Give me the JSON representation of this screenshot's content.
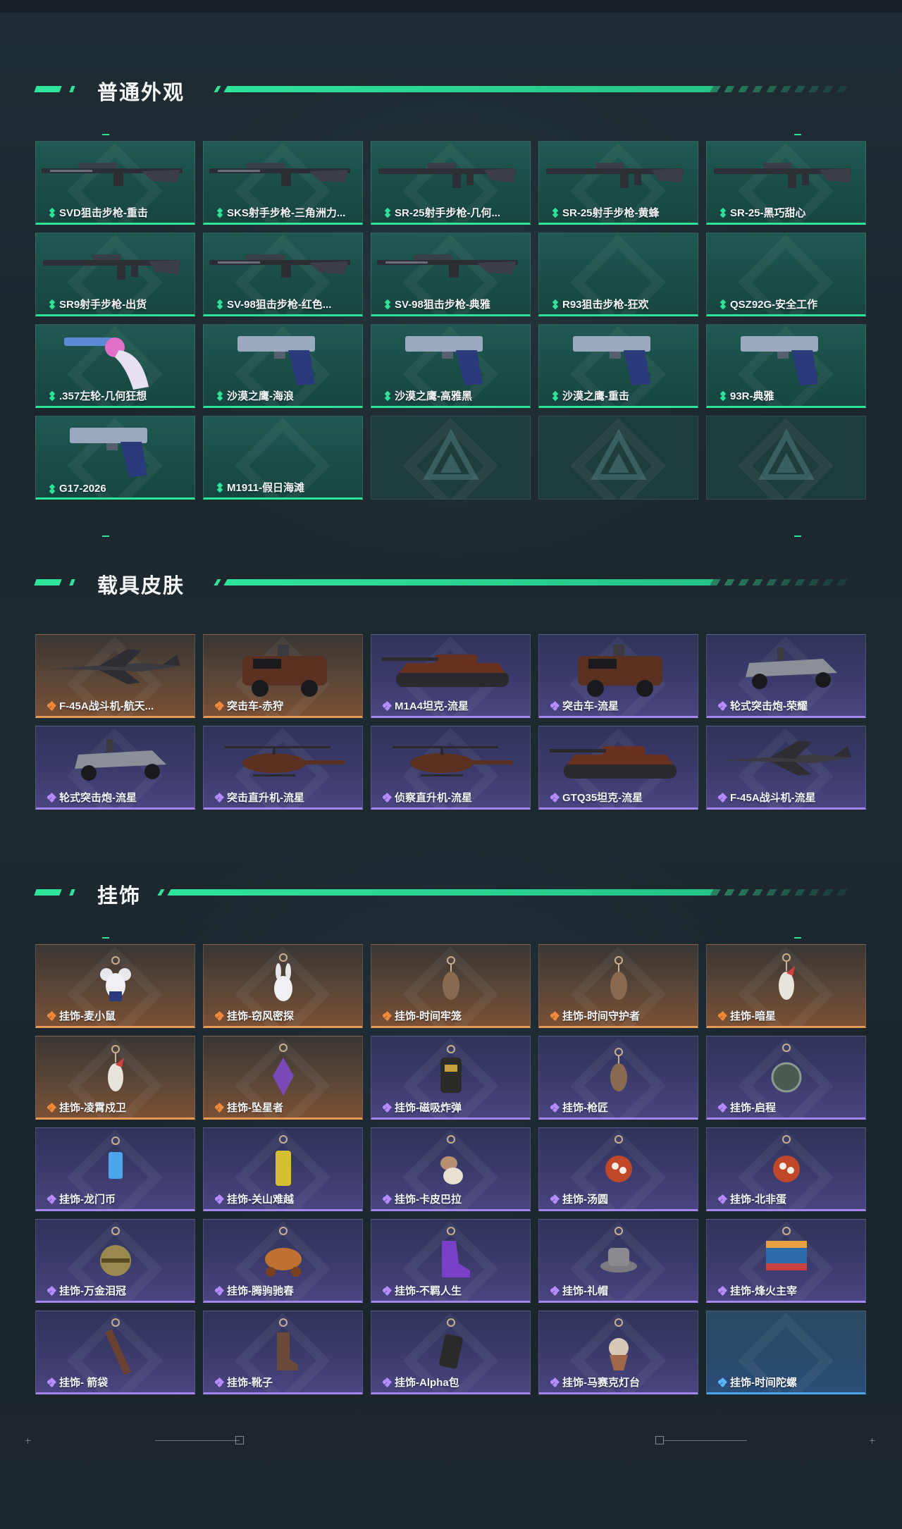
{
  "sections": [
    {
      "title": "普通外观",
      "items": [
        {
          "label": "SVD狙击步枪-重击",
          "rarity": "green",
          "icon": "sniper-rifle"
        },
        {
          "label": "SKS射手步枪-三角洲力...",
          "rarity": "green",
          "icon": "sniper-rifle"
        },
        {
          "label": "SR-25射手步枪-几何...",
          "rarity": "green",
          "icon": "rifle"
        },
        {
          "label": "SR-25射手步枪-黄蜂",
          "rarity": "green",
          "icon": "rifle"
        },
        {
          "label": "SR-25-黑巧甜心",
          "rarity": "green",
          "icon": "rifle"
        },
        {
          "label": "SR9射手步枪-出货",
          "rarity": "green",
          "icon": "rifle"
        },
        {
          "label": "SV-98狙击步枪-红色...",
          "rarity": "green",
          "icon": "sniper-rifle"
        },
        {
          "label": "SV-98狙击步枪-典雅",
          "rarity": "green",
          "icon": "sniper-rifle"
        },
        {
          "label": "R93狙击步枪-狂欢",
          "rarity": "green",
          "icon": ""
        },
        {
          "label": "QSZ92G-安全工作",
          "rarity": "green",
          "icon": ""
        },
        {
          "label": ".357左轮-几何狂想",
          "rarity": "green",
          "icon": "revolver"
        },
        {
          "label": "沙漠之鹰-海浪",
          "rarity": "green",
          "icon": "pistol"
        },
        {
          "label": "沙漠之鹰-高雅黑",
          "rarity": "green",
          "icon": "pistol"
        },
        {
          "label": "沙漠之鹰-重击",
          "rarity": "green",
          "icon": "pistol"
        },
        {
          "label": "93R-典雅",
          "rarity": "green",
          "icon": "pistol"
        },
        {
          "label": "G17-2026",
          "rarity": "green",
          "icon": "pistol"
        },
        {
          "label": "M1911-假日海滩",
          "rarity": "green",
          "icon": ""
        },
        {
          "label": "",
          "rarity": "empty",
          "icon": "delta-emblem"
        },
        {
          "label": "",
          "rarity": "empty",
          "icon": "delta-emblem"
        },
        {
          "label": "",
          "rarity": "empty",
          "icon": "delta-emblem"
        }
      ]
    },
    {
      "title": "载具皮肤",
      "items": [
        {
          "label": "F-45A战斗机-航天...",
          "rarity": "orange",
          "icon": "fighter-jet"
        },
        {
          "label": "突击车-赤狩",
          "rarity": "orange",
          "icon": "assault-vehicle"
        },
        {
          "label": "M1A4坦克-流星",
          "rarity": "purple",
          "icon": "tank"
        },
        {
          "label": "突击车-流星",
          "rarity": "purple",
          "icon": "assault-vehicle"
        },
        {
          "label": "轮式突击炮-荣耀",
          "rarity": "purple",
          "icon": "wheeled-vehicle"
        },
        {
          "label": "轮式突击炮-流星",
          "rarity": "purple",
          "icon": "wheeled-vehicle"
        },
        {
          "label": "突击直升机-流星",
          "rarity": "purple",
          "icon": "helicopter"
        },
        {
          "label": "侦察直升机-流星",
          "rarity": "purple",
          "icon": "helicopter"
        },
        {
          "label": "GTQ35坦克-流星",
          "rarity": "purple",
          "icon": "tank"
        },
        {
          "label": "F-45A战斗机-流星",
          "rarity": "purple",
          "icon": "fighter-jet"
        }
      ]
    },
    {
      "title": "挂饰",
      "items": [
        {
          "label": "挂饰-麦小鼠",
          "rarity": "orange",
          "icon": "mouse-charm"
        },
        {
          "label": "挂饰-窃风密探",
          "rarity": "orange",
          "icon": "rabbit-charm"
        },
        {
          "label": "挂饰-时间牢笼",
          "rarity": "orange",
          "icon": "charm"
        },
        {
          "label": "挂饰-时间守护者",
          "rarity": "orange",
          "icon": "charm"
        },
        {
          "label": "挂饰-暗星",
          "rarity": "orange",
          "icon": "bird-charm"
        },
        {
          "label": "挂饰-凌霄戍卫",
          "rarity": "orange",
          "icon": "bird-charm"
        },
        {
          "label": "挂饰-坠星者",
          "rarity": "orange",
          "icon": "crystal-charm"
        },
        {
          "label": "挂饰-磁吸炸弹",
          "rarity": "purple",
          "icon": "bomb-charm"
        },
        {
          "label": "挂饰-枪匠",
          "rarity": "purple",
          "icon": "charm"
        },
        {
          "label": "挂饰-启程",
          "rarity": "purple",
          "icon": "compass-charm"
        },
        {
          "label": "挂饰-龙门币",
          "rarity": "purple",
          "icon": "card-charm"
        },
        {
          "label": "挂饰-关山难越",
          "rarity": "purple",
          "icon": "cylinder-charm"
        },
        {
          "label": "挂饰-卡皮巴拉",
          "rarity": "purple",
          "icon": "capybara-charm"
        },
        {
          "label": "挂饰-汤圆",
          "rarity": "purple",
          "icon": "bowl-charm"
        },
        {
          "label": "挂饰-北非蛋",
          "rarity": "purple",
          "icon": "bowl-charm"
        },
        {
          "label": "挂饰-万金泪冠",
          "rarity": "purple",
          "icon": "crown-charm"
        },
        {
          "label": "挂饰-腾驹驰春",
          "rarity": "purple",
          "icon": "carriage-charm"
        },
        {
          "label": "挂饰-不羁人生",
          "rarity": "purple",
          "icon": "shoe-charm"
        },
        {
          "label": "挂饰-礼帽",
          "rarity": "purple",
          "icon": "hat-charm"
        },
        {
          "label": "挂饰-烽火主宰",
          "rarity": "purple",
          "icon": "banner-charm"
        },
        {
          "label": "挂饰- 箭袋",
          "rarity": "purple",
          "icon": "quiver-charm"
        },
        {
          "label": "挂饰-靴子",
          "rarity": "purple",
          "icon": "boot-charm"
        },
        {
          "label": "挂饰-Alpha包",
          "rarity": "purple",
          "icon": "bag-charm"
        },
        {
          "label": "挂饰-马赛克灯台",
          "rarity": "purple",
          "icon": "lamp-charm"
        },
        {
          "label": "挂饰-时间陀螺",
          "rarity": "blue",
          "icon": ""
        }
      ]
    }
  ],
  "colors": {
    "accent": "#2fe39b",
    "green_card": "#1f5a52",
    "orange_card": "#7a5035",
    "purple_card": "#4a4480",
    "blue_card": "#2a4e78"
  }
}
